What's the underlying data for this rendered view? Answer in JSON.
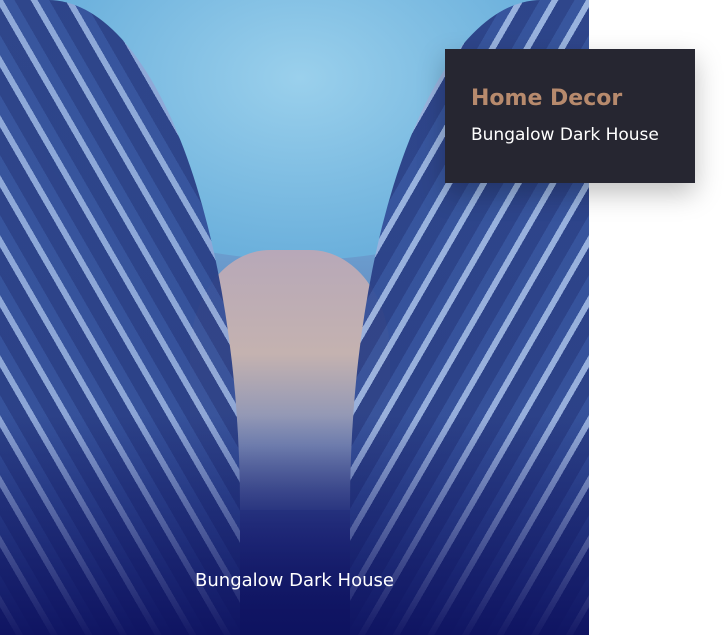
{
  "photo": {
    "caption": "Bungalow Dark House"
  },
  "card": {
    "category": "Home Decor",
    "title": "Bungalow Dark House",
    "accent_color": "#b78a6d",
    "background_color": "#262631"
  }
}
